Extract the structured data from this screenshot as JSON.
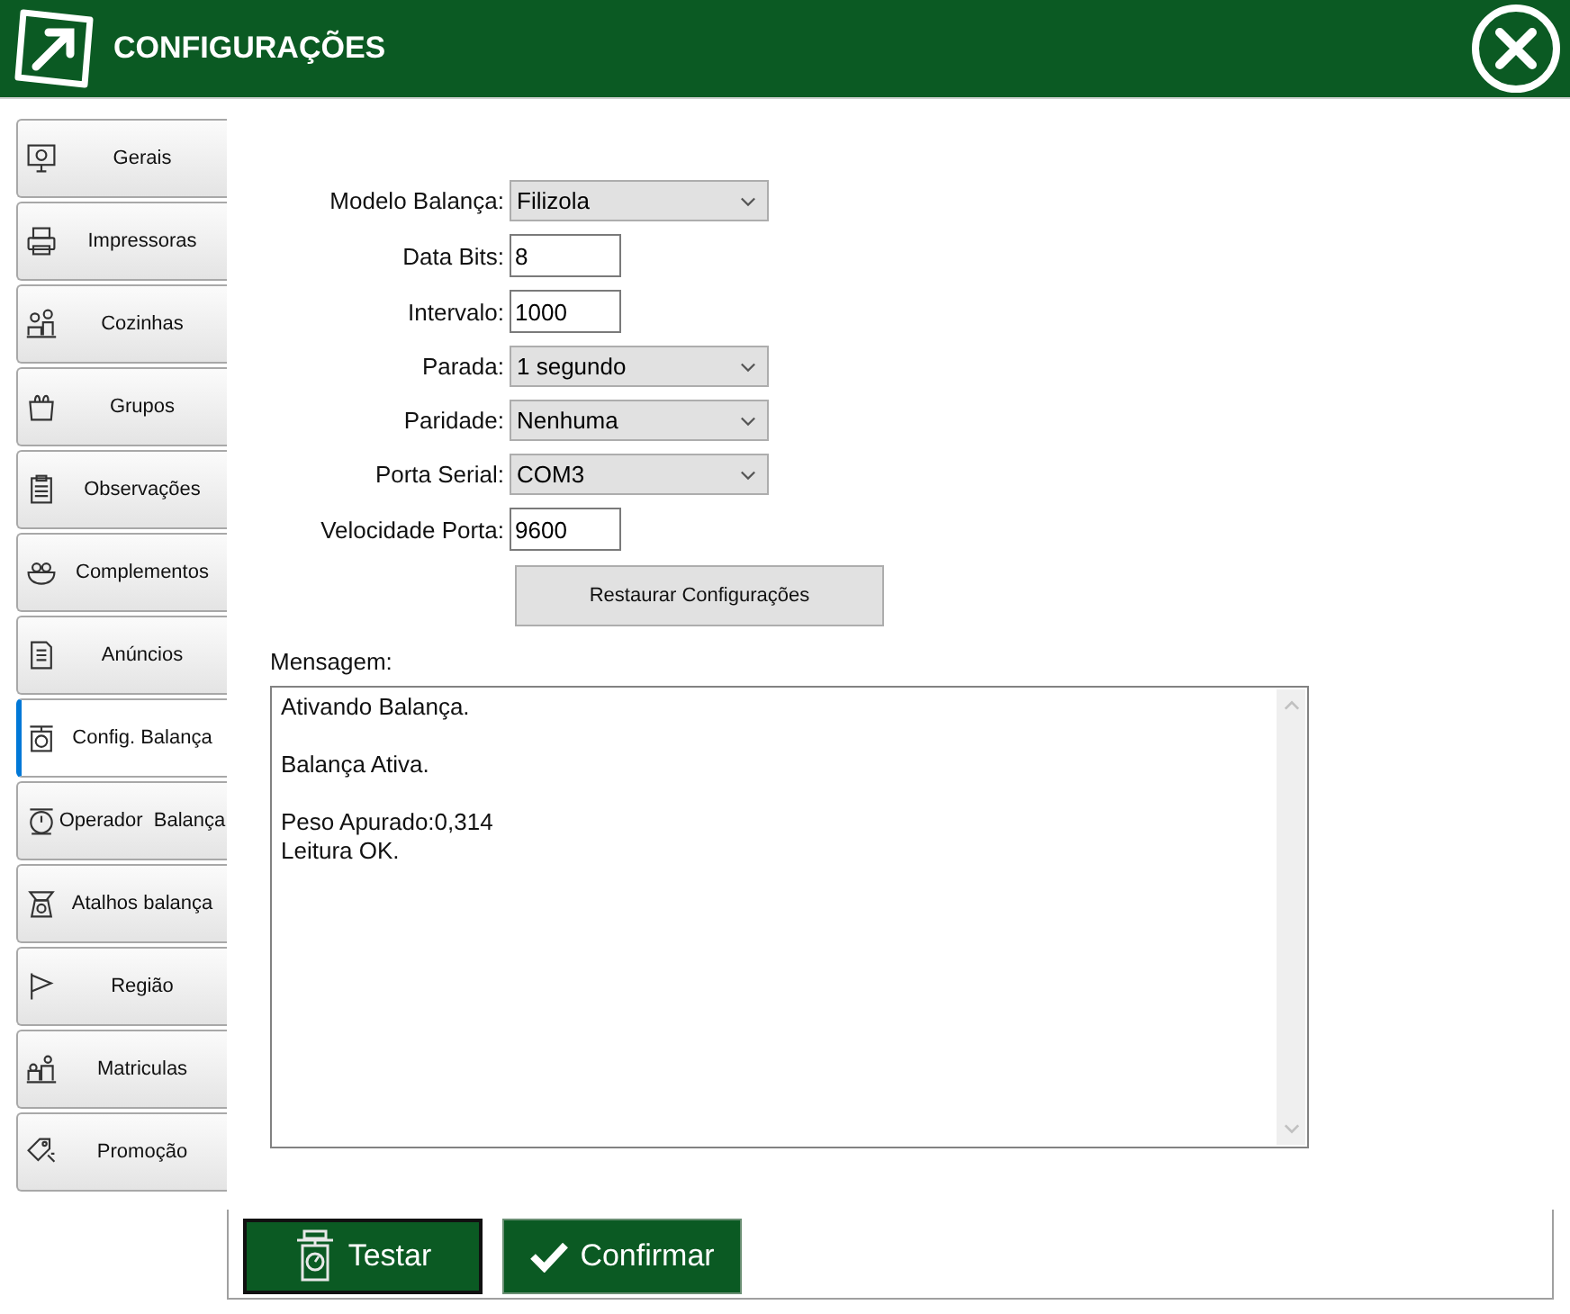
{
  "window": {
    "title": "CONFIGURAÇÕES"
  },
  "sidebar": {
    "items": [
      {
        "label": "Gerais",
        "selected": false
      },
      {
        "label": "Impressoras",
        "selected": false
      },
      {
        "label": "Cozinhas",
        "selected": false
      },
      {
        "label": "Grupos",
        "selected": false
      },
      {
        "label": "Observações",
        "selected": false
      },
      {
        "label": "Complementos",
        "selected": false
      },
      {
        "label": "Anúncios",
        "selected": false
      },
      {
        "label": "Config. Balança",
        "selected": true
      },
      {
        "label": "Operador  Balança",
        "selected": false
      },
      {
        "label": "Atalhos balança",
        "selected": false
      },
      {
        "label": "Região",
        "selected": false
      },
      {
        "label": "Matriculas",
        "selected": false
      },
      {
        "label": "Promoção",
        "selected": false
      }
    ]
  },
  "form": {
    "fields": [
      {
        "label": "Modelo Balança:",
        "kind": "select",
        "value": "Filizola"
      },
      {
        "label": "Data Bits:",
        "kind": "text",
        "value": "8"
      },
      {
        "label": "Intervalo:",
        "kind": "text",
        "value": "1000"
      },
      {
        "label": "Parada:",
        "kind": "select",
        "value": "1 segundo"
      },
      {
        "label": "Paridade:",
        "kind": "select",
        "value": "Nenhuma"
      },
      {
        "label": "Porta Serial:",
        "kind": "select",
        "value": "COM3"
      },
      {
        "label": "Velocidade Porta:",
        "kind": "text",
        "value": "9600"
      }
    ],
    "restore_button": "Restaurar Configurações"
  },
  "message": {
    "label": "Mensagem:",
    "paragraphs": [
      [
        "Ativando Balança."
      ],
      [
        "Balança Ativa."
      ],
      [
        "Peso Apurado:0,314",
        "Leitura OK."
      ]
    ]
  },
  "buttons": [
    {
      "label": "Testar",
      "kind": "test"
    },
    {
      "label": "Confirmar",
      "kind": "confirm"
    }
  ]
}
